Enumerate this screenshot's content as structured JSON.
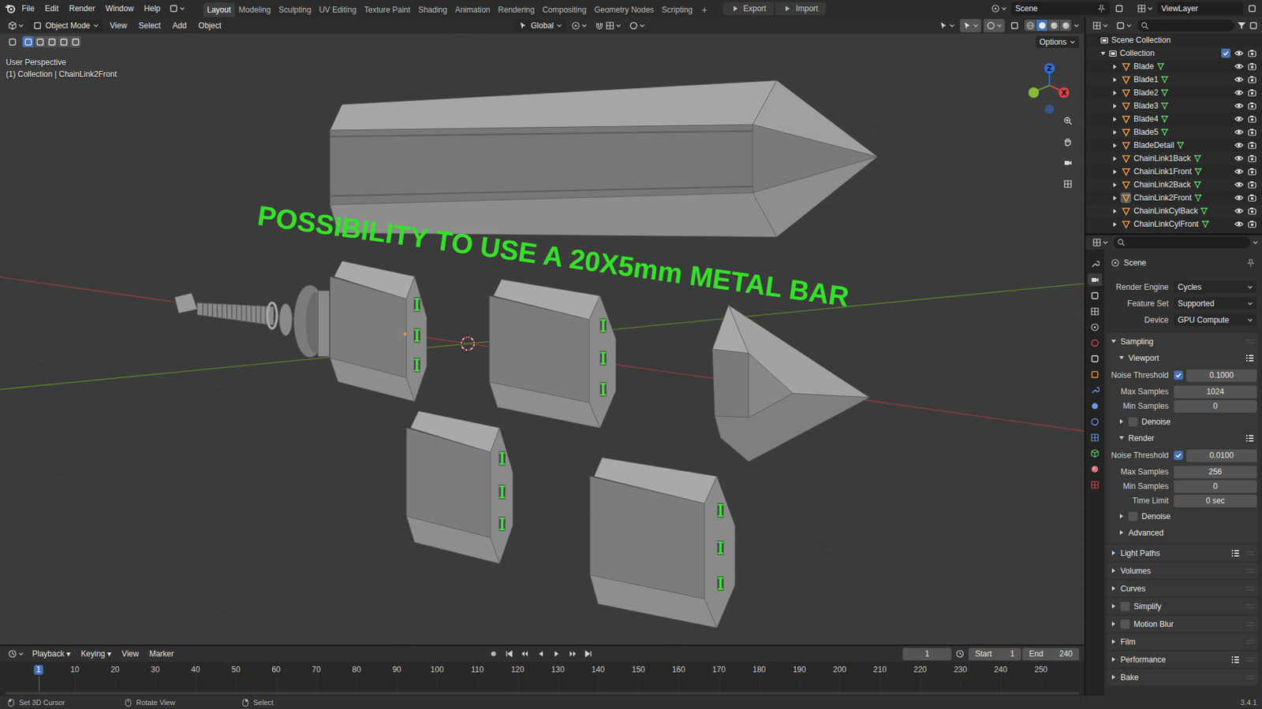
{
  "topbar": {
    "menus": [
      "File",
      "Edit",
      "Render",
      "Window",
      "Help"
    ],
    "workspaces": [
      {
        "label": "Layout",
        "selected": true
      },
      {
        "label": "Modeling",
        "selected": false
      },
      {
        "label": "Sculpting",
        "selected": false
      },
      {
        "label": "UV Editing",
        "selected": false
      },
      {
        "label": "Texture Paint",
        "selected": false
      },
      {
        "label": "Shading",
        "selected": false
      },
      {
        "label": "Animation",
        "selected": false
      },
      {
        "label": "Rendering",
        "selected": false
      },
      {
        "label": "Compositing",
        "selected": false
      },
      {
        "label": "Geometry Nodes",
        "selected": false
      },
      {
        "label": "Scripting",
        "selected": false
      }
    ],
    "add_workspace": "+",
    "transfer_buttons": [
      "Export",
      "Import"
    ],
    "scene": "Scene",
    "view_layer": "ViewLayer"
  },
  "viewport": {
    "mode": "Object Mode",
    "menus": [
      "View",
      "Select",
      "Add",
      "Object"
    ],
    "orientation": "Global",
    "options": "Options",
    "select_modes": [
      {
        "selected": true
      },
      {
        "selected": false
      },
      {
        "selected": false
      },
      {
        "selected": false
      },
      {
        "selected": false
      }
    ],
    "shading_modes": [
      {
        "selected": false
      },
      {
        "selected": true
      },
      {
        "selected": false
      },
      {
        "selected": false
      }
    ],
    "info": [
      "User Perspective",
      "(1) Collection | ChainLink2Front"
    ],
    "overlay_text": "POSSIBILITY TO USE A 20X5mm METAL BAR",
    "gizmo_axes": [
      {
        "label": "Z",
        "color": "#2f6fd6"
      },
      {
        "label": "X",
        "color": "#e0404a"
      }
    ]
  },
  "outliner": {
    "root": "Scene Collection",
    "collection": {
      "name": "Collection",
      "expanded": true,
      "checked": true
    },
    "items": [
      {
        "name": "Blade",
        "selected": false
      },
      {
        "name": "Blade1",
        "selected": false
      },
      {
        "name": "Blade2",
        "selected": false
      },
      {
        "name": "Blade3",
        "selected": false
      },
      {
        "name": "Blade4",
        "selected": false
      },
      {
        "name": "Blade5",
        "selected": false
      },
      {
        "name": "BladeDetail",
        "selected": false
      },
      {
        "name": "ChainLink1Back",
        "selected": false
      },
      {
        "name": "ChainLink1Front",
        "selected": false
      },
      {
        "name": "ChainLink2Back",
        "selected": false
      },
      {
        "name": "ChainLink2Front",
        "selected": true
      },
      {
        "name": "ChainLinkCylBack",
        "selected": false
      },
      {
        "name": "ChainLinkCylFront",
        "selected": false
      }
    ]
  },
  "properties": {
    "tabs": [
      {
        "selected": false
      },
      {
        "selected": true
      },
      {
        "selected": false
      },
      {
        "selected": false
      },
      {
        "selected": false
      },
      {
        "selected": false
      },
      {
        "selected": false
      },
      {
        "selected": false
      },
      {
        "selected": false
      },
      {
        "selected": false
      },
      {
        "selected": false
      },
      {
        "selected": false
      },
      {
        "selected": false
      },
      {
        "selected": false
      },
      {
        "selected": false
      }
    ],
    "title": "Scene",
    "fields": [
      {
        "label": "Render Engine",
        "value": "Cycles"
      },
      {
        "label": "Feature Set",
        "value": "Supported"
      },
      {
        "label": "Device",
        "value": "GPU Compute"
      }
    ],
    "sampling": {
      "label": "Sampling",
      "expanded": true,
      "sections": [
        {
          "label": "Viewport",
          "kind": "group",
          "expanded": true,
          "rows": [
            {
              "label": "Noise Threshold",
              "value": "0.1000",
              "kind": "check",
              "checked": true
            },
            {
              "label": "Max Samples",
              "value": "1024",
              "kind": "number"
            },
            {
              "label": "Min Samples",
              "value": "0",
              "kind": "number"
            }
          ]
        },
        {
          "label": "Denoise",
          "kind": "toggle",
          "expanded": false,
          "checked": false
        },
        {
          "label": "Render",
          "kind": "group",
          "expanded": true,
          "rows": [
            {
              "label": "Noise Threshold",
              "value": "0.0100",
              "kind": "check",
              "checked": true
            },
            {
              "label": "Max Samples",
              "value": "256",
              "kind": "number"
            },
            {
              "label": "Min Samples",
              "value": "0",
              "kind": "number"
            },
            {
              "label": "Time Limit",
              "value": "0 sec",
              "kind": "number"
            }
          ]
        },
        {
          "label": "Denoise",
          "kind": "toggle",
          "expanded": false,
          "checked": false
        },
        {
          "label": "Advanced",
          "kind": "plain",
          "expanded": false
        }
      ]
    },
    "panels": [
      {
        "label": "Light Paths",
        "kind": "presets",
        "expanded": false
      },
      {
        "label": "Volumes",
        "kind": "plain",
        "expanded": false
      },
      {
        "label": "Curves",
        "kind": "plain",
        "expanded": false
      },
      {
        "label": "Simplify",
        "kind": "toggle",
        "expanded": false,
        "checked": false
      },
      {
        "label": "Motion Blur",
        "kind": "toggle",
        "expanded": false,
        "checked": false
      },
      {
        "label": "Film",
        "kind": "plain",
        "expanded": false
      },
      {
        "label": "Performance",
        "kind": "presets",
        "expanded": false
      },
      {
        "label": "Bake",
        "kind": "plain",
        "expanded": false
      }
    ]
  },
  "timeline": {
    "menus": [
      "Playback",
      "Keying",
      "View",
      "Marker"
    ],
    "current_frame": "1",
    "start": {
      "label": "Start",
      "value": "1"
    },
    "end": {
      "label": "End",
      "value": "240"
    },
    "ticks": [
      {
        "label": "1",
        "selected": true
      },
      {
        "label": "10",
        "selected": false
      },
      {
        "label": "20",
        "selected": false
      },
      {
        "label": "30",
        "selected": false
      },
      {
        "label": "40",
        "selected": false
      },
      {
        "label": "50",
        "selected": false
      },
      {
        "label": "60",
        "selected": false
      },
      {
        "label": "70",
        "selected": false
      },
      {
        "label": "80",
        "selected": false
      },
      {
        "label": "90",
        "selected": false
      },
      {
        "label": "100",
        "selected": false
      },
      {
        "label": "110",
        "selected": false
      },
      {
        "label": "120",
        "selected": false
      },
      {
        "label": "130",
        "selected": false
      },
      {
        "label": "140",
        "selected": false
      },
      {
        "label": "150",
        "selected": false
      },
      {
        "label": "160",
        "selected": false
      },
      {
        "label": "170",
        "selected": false
      },
      {
        "label": "180",
        "selected": false
      },
      {
        "label": "190",
        "selected": false
      },
      {
        "label": "200",
        "selected": false
      },
      {
        "label": "210",
        "selected": false
      },
      {
        "label": "220",
        "selected": false
      },
      {
        "label": "230",
        "selected": false
      },
      {
        "label": "240",
        "selected": false
      },
      {
        "label": "250",
        "selected": false
      }
    ]
  },
  "status_bar": {
    "items": [
      "Set 3D Cursor",
      "Rotate View",
      "Select"
    ],
    "version": "3.4.1"
  }
}
